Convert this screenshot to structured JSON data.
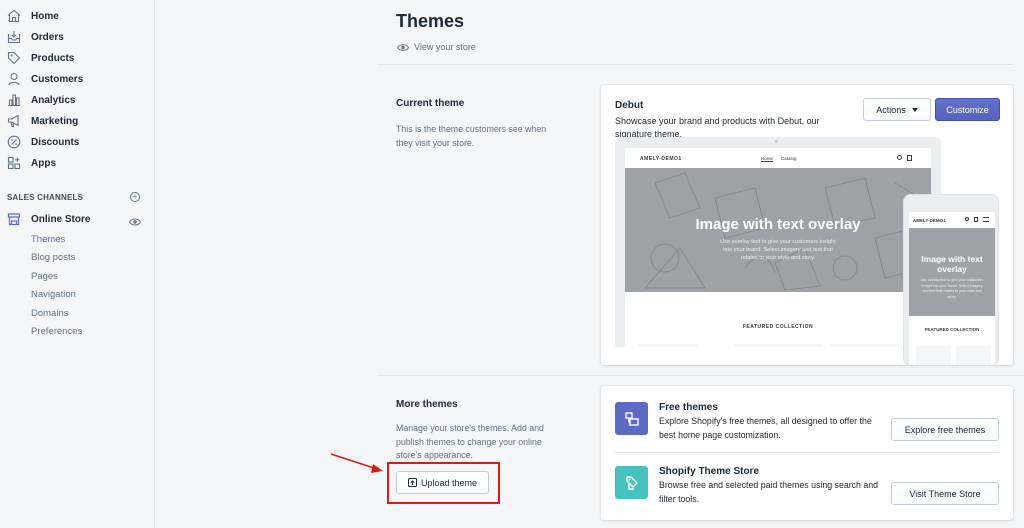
{
  "sidebar": {
    "items": [
      {
        "label": "Home",
        "icon": "home-icon"
      },
      {
        "label": "Orders",
        "icon": "orders-icon"
      },
      {
        "label": "Products",
        "icon": "tag-icon"
      },
      {
        "label": "Customers",
        "icon": "person-icon"
      },
      {
        "label": "Analytics",
        "icon": "bar-chart-icon"
      },
      {
        "label": "Marketing",
        "icon": "megaphone-icon"
      },
      {
        "label": "Discounts",
        "icon": "discount-icon"
      },
      {
        "label": "Apps",
        "icon": "apps-icon"
      }
    ],
    "channels_heading": "SALES CHANNELS",
    "online_store": {
      "label": "Online Store",
      "icon": "store-icon"
    },
    "sub_items": [
      "Themes",
      "Blog posts",
      "Pages",
      "Navigation",
      "Domains",
      "Preferences"
    ],
    "active_sub": "Themes"
  },
  "page": {
    "title": "Themes",
    "view_store": "View your store"
  },
  "current_theme": {
    "heading": "Current theme",
    "description": "This is the theme customers see when they visit your store.",
    "theme_name": "Debut",
    "theme_desc": "Showcase your brand and products with Debut, our signature theme.",
    "actions_label": "Actions",
    "customize_label": "Customize",
    "preview": {
      "store_name": "AMELY-DEMO1",
      "nav_home": "Home",
      "nav_catalog": "Catalog",
      "hero_title": "Image with text overlay",
      "hero_sub": "Use overlay text to give your customers insight into your brand. Select imagery and text that relates to your style and story.",
      "featured": "FEATURED COLLECTION"
    }
  },
  "more_themes": {
    "heading": "More themes",
    "description": "Manage your store's themes. Add and publish themes to change your online store's appearance.",
    "upload_label": "Upload theme",
    "free": {
      "title": "Free themes",
      "desc": "Explore Shopify's free themes, all designed to offer the best home page customization.",
      "button": "Explore free themes"
    },
    "store": {
      "title": "Shopify Theme Store",
      "desc": "Browse free and selected paid themes using search and filter tools.",
      "button": "Visit Theme Store"
    }
  },
  "colors": {
    "accent": "#5c6ac4",
    "teal": "#47c1bf",
    "highlight": "#e0161b"
  }
}
